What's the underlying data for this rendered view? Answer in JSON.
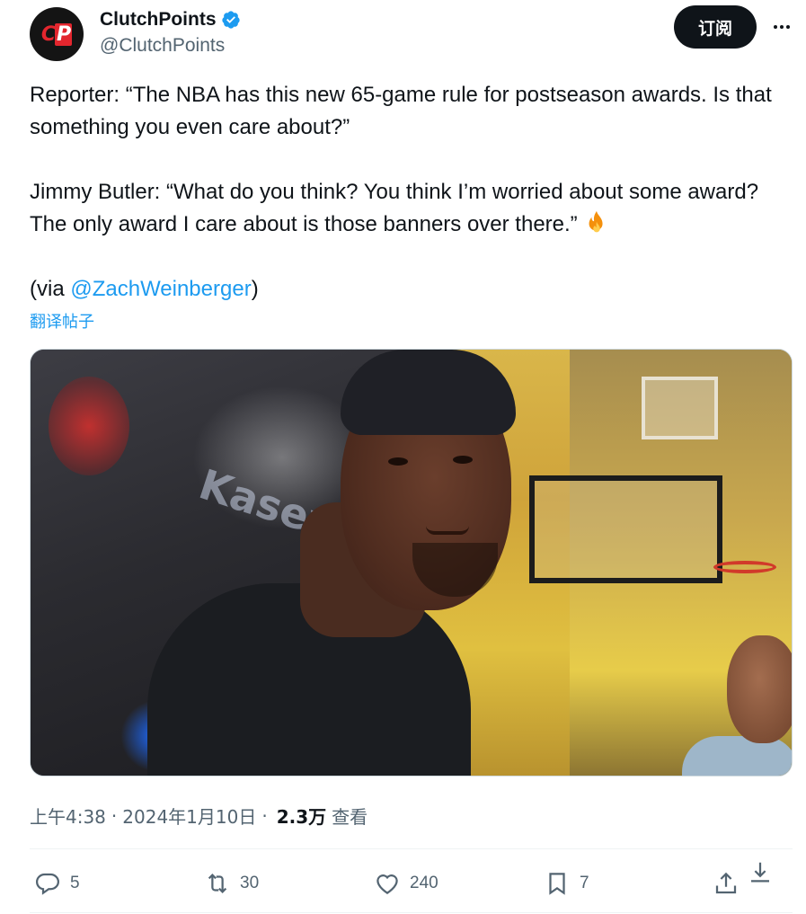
{
  "author": {
    "display_name": "ClutchPoints",
    "handle": "@ClutchPoints",
    "avatar_logo_text": "CP",
    "verified": true
  },
  "header": {
    "subscribe_label": "订阅",
    "more_icon": "more-horizontal-icon"
  },
  "tweet": {
    "paragraph1": "Reporter: “The NBA has this new 65-game rule for postseason awards. Is that something you even care about?”",
    "paragraph2": "Jimmy Butler: “What do you think? You think I’m worried about some award? The only award I care about is those banners over there.”",
    "paragraph2_emoji": "fire-icon",
    "via_prefix": "(via ",
    "via_link": "@ZachWeinberger",
    "via_suffix": ")",
    "translate_label": "翻译帖子"
  },
  "media": {
    "sponsor_text": "Kaseya"
  },
  "meta": {
    "time": "上午4:38",
    "separator": "·",
    "date": "2024年1月10日",
    "views_count": "2.3万",
    "views_label": "查看"
  },
  "actions": {
    "replies": "5",
    "reposts": "30",
    "likes": "240",
    "bookmarks": "7"
  },
  "colors": {
    "accent": "#1d9bf0",
    "text_primary": "#0f1419",
    "text_secondary": "#536471",
    "brand_red": "#e3262e"
  }
}
